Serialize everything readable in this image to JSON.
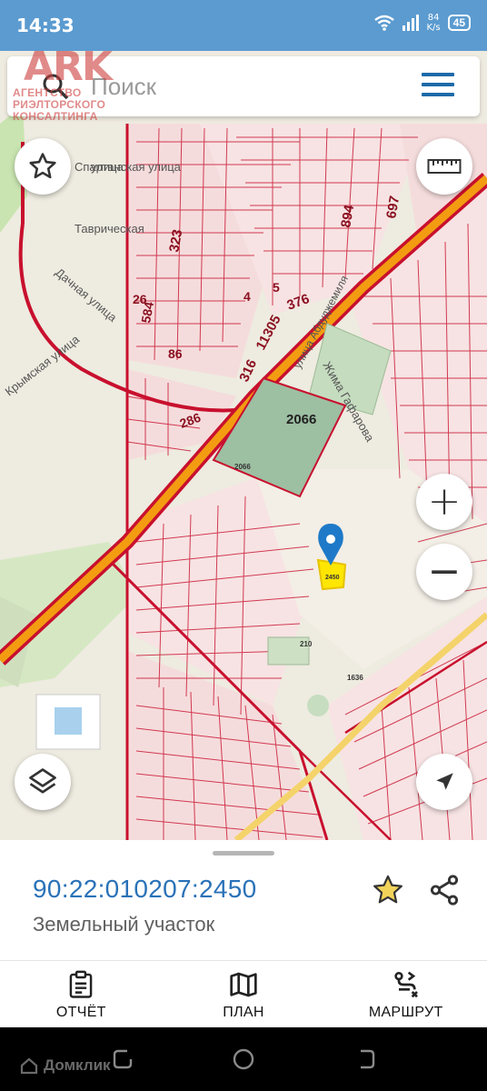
{
  "status_bar": {
    "time": "14:33",
    "speed_value": "84",
    "speed_unit": "K/s",
    "battery": "45"
  },
  "watermark": {
    "logo": "ARK",
    "line1": "АГЕНТСТВО",
    "line2": "РИЭЛТОРСКОГО",
    "line3": "КОНСАЛТИНГА"
  },
  "search": {
    "placeholder": "Поиск"
  },
  "map": {
    "street_labels": [
      "Спартанская улица",
      "улица",
      "Тавричеcкая",
      "Дачная улица",
      "Крымская улица",
      "улица Абдуджемиля",
      "Жима Гафарова"
    ],
    "parcel_labels": [
      "2066",
      "323",
      "894",
      "697",
      "11305",
      "376",
      "316",
      "286",
      "584",
      "86",
      "26",
      "4",
      "5",
      "2066",
      "210",
      "1636"
    ],
    "selected_parcel": "2450"
  },
  "map_controls": {
    "favorite_icon": "star-outline-icon",
    "ruler_icon": "ruler-icon",
    "zoom_in": "+",
    "zoom_out": "−",
    "layers_icon": "layers-icon",
    "locate_icon": "navigation-arrow-icon"
  },
  "parcel": {
    "cadastral_number": "90:22:010207:2450",
    "type": "Земельный участок"
  },
  "tabs": [
    {
      "label": "ОТЧЁТ",
      "icon": "clipboard-icon"
    },
    {
      "label": "ПЛАН",
      "icon": "map-icon"
    },
    {
      "label": "МАРШРУТ",
      "icon": "route-icon"
    }
  ],
  "nav_bar": {
    "app_badge": "Домклик"
  },
  "colors": {
    "status_bar": "#5b9bd0",
    "accent": "#2a72b8",
    "parcel_lines": "#c8102e",
    "road_main": "#f39c12",
    "star": "#e0b020"
  }
}
